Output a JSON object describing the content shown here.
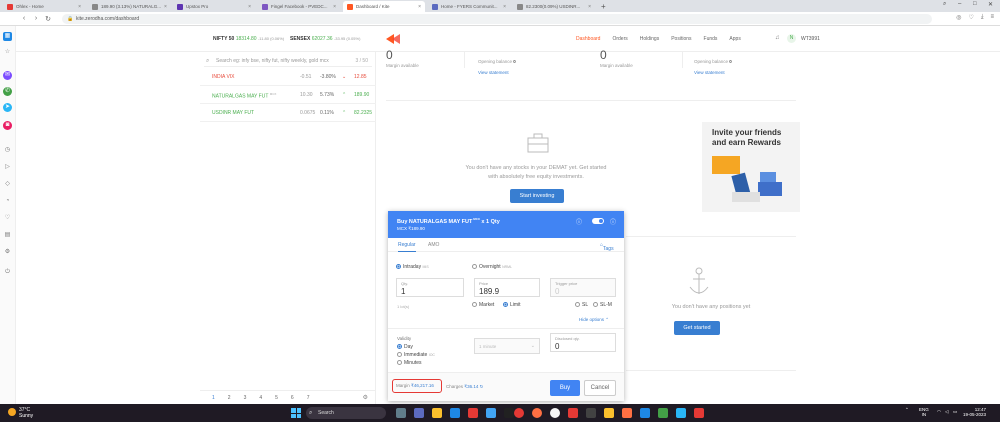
{
  "browser": {
    "tabs": [
      {
        "title": "Ohlex - Home",
        "color": "#e53935"
      },
      {
        "title": "189.90 (3.13%) NATURALG...",
        "color": "#888888"
      },
      {
        "title": "Upstox Pro",
        "color": "#5e35b1"
      },
      {
        "title": "Fingel Facebook - PVEDC...",
        "color": "#7e57c2"
      },
      {
        "title": "Dashboard / Kite",
        "color": "#ff5722"
      },
      {
        "title": "Home - FYERS Communit...",
        "color": "#5c6bc0"
      },
      {
        "title": "82.2300(0.09%) USDINR...",
        "color": "#888888"
      }
    ],
    "url": "kite.zerodha.com/dashboard"
  },
  "header": {
    "indices": [
      {
        "name": "NIFTY 50",
        "value": "18314.80",
        "change": "-11.80 (0.06%)"
      },
      {
        "name": "SENSEX",
        "value": "62027.36",
        "change": "-33.95 (0.05%)"
      }
    ],
    "nav": [
      "Dashboard",
      "Orders",
      "Holdings",
      "Positions",
      "Funds",
      "Apps"
    ],
    "avatar_initials": "N",
    "user_id": "WT3991"
  },
  "marketwatch": {
    "search_placeholder": "Search eg: infy bse, nifty fut, nifty weekly, gold mcx",
    "count": "3 / 50",
    "rows": [
      {
        "symbol": "INDIA VIX",
        "sub": "",
        "change": "-0.51",
        "percent": "-3.80%",
        "dir": "down",
        "ltp": "12.85"
      },
      {
        "symbol": "NATURALGAS MAY FUT",
        "sub": "MCX",
        "change": "10.30",
        "percent": "5.73%",
        "dir": "up",
        "ltp": "189.90"
      },
      {
        "symbol": "USDINR MAY FUT",
        "sub": "",
        "change": "0.0675",
        "percent": "0.11%",
        "dir": "up",
        "ltp": "82.2325"
      }
    ],
    "pages": [
      "1",
      "2",
      "3",
      "4",
      "5",
      "6",
      "7"
    ]
  },
  "dashboard": {
    "equity": {
      "value": "0",
      "margin_label": "Margin available",
      "opening_label": "Opening balance",
      "opening_value": "0",
      "link": "View statement"
    },
    "commodity": {
      "value": "0",
      "margin_label": "Margin available",
      "opening_label": "Opening balance",
      "opening_value": "0",
      "link": "View statement"
    },
    "holdings_empty": {
      "line1": "You don't have any stocks in your DEMAT yet. Get started",
      "line2": "with absolutely free equity investments.",
      "button": "Start investing"
    },
    "positions_empty": {
      "text": "You don't have any positions yet",
      "button": "Get started"
    },
    "promo": {
      "line1": "Invite your friends",
      "line2": "and earn Rewards"
    }
  },
  "order_window": {
    "title": "Buy  NATURALGAS MAY FUT",
    "qty_suffix": "x 1 Qty",
    "exchange_price": "MCX ₹189.90",
    "tabs": [
      "Regular",
      "AMO"
    ],
    "tags_label": "Tags",
    "product": [
      {
        "label": "Intraday",
        "note": "MIS",
        "selected": true
      },
      {
        "label": "Overnight",
        "note": "NRML",
        "selected": false
      }
    ],
    "qty": {
      "label": "Qty.",
      "value": "1"
    },
    "price": {
      "label": "Price",
      "value": "189.9"
    },
    "trigger": {
      "label": "Trigger price",
      "value": "0"
    },
    "lot_note": "1 lot(s)",
    "order_types": [
      {
        "label": "Market",
        "selected": false
      },
      {
        "label": "Limit",
        "selected": true
      },
      {
        "label": "SL",
        "selected": false
      },
      {
        "label": "SL-M",
        "selected": false
      }
    ],
    "hide_options": "Hide options",
    "validity_label": "Validity",
    "validity": [
      {
        "label": "Day",
        "note": "",
        "selected": true
      },
      {
        "label": "Immediate",
        "note": "IOC",
        "selected": false
      },
      {
        "label": "Minutes",
        "note": "",
        "selected": false
      }
    ],
    "minutes_select": "1 minute",
    "disclosed": {
      "label": "Disclosed qty.",
      "value": "0"
    },
    "margin_label": "Margin",
    "margin_value": "₹46,217.16",
    "charges_label": "Charges",
    "charges_value": "₹36.14",
    "buy": "Buy",
    "cancel": "Cancel"
  },
  "taskbar": {
    "temp": "37°C",
    "condition": "Sunny",
    "search": "Search",
    "lang": "ENG",
    "region": "IN",
    "time": "12:47",
    "date": "19-05-2023"
  }
}
